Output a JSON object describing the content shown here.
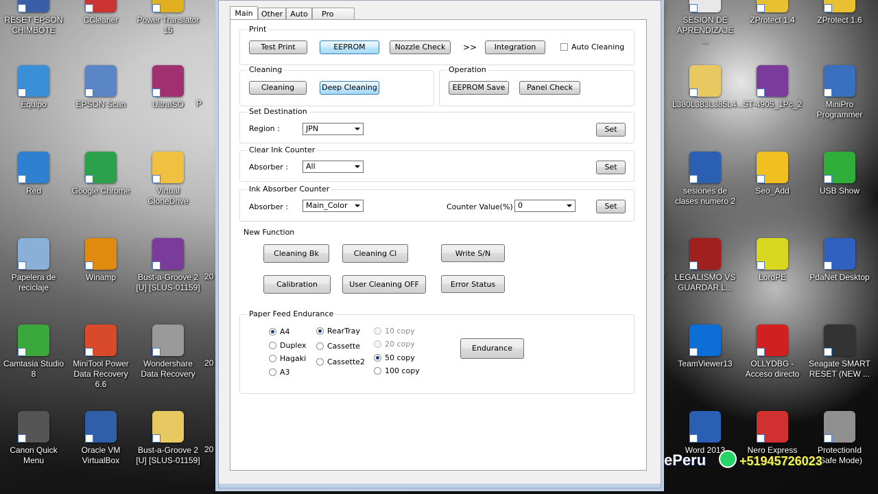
{
  "desktop_left": [
    {
      "label": "RESET EPSON CHIMBOTE",
      "icon": "epson-reset-icon",
      "color": "#3a5fa8"
    },
    {
      "label": "CCleaner",
      "icon": "ccleaner-icon",
      "color": "#cc3333"
    },
    {
      "label": "Power Translator 15",
      "icon": "translator-icon",
      "color": "#e0b020"
    },
    {
      "label": "Equipo",
      "icon": "computer-icon",
      "color": "#3b8fd8"
    },
    {
      "label": "EPSON Scan",
      "icon": "scanner-icon",
      "color": "#5a86c8"
    },
    {
      "label": "UltraISO",
      "icon": "disc-icon",
      "color": "#a03070"
    },
    {
      "label": "Red",
      "icon": "network-icon",
      "color": "#2f80d0"
    },
    {
      "label": "Google Chrome",
      "icon": "chrome-icon",
      "color": "#2aa14a"
    },
    {
      "label": "Virtual CloneDrive",
      "icon": "sheep-icon",
      "color": "#f0c040"
    },
    {
      "label": "Papelera de reciclaje",
      "icon": "recycle-bin-icon",
      "color": "#8ab0d8"
    },
    {
      "label": "Winamp",
      "icon": "winamp-icon",
      "color": "#e08a10"
    },
    {
      "label": "Bust-a-Groove 2 [U] [SLUS-01159]",
      "icon": "archive-icon",
      "color": "#7a3b9a"
    },
    {
      "label": "Camtasia Studio 8",
      "icon": "camtasia-icon",
      "color": "#3aa83a"
    },
    {
      "label": "MiniTool Power Data Recovery 6.6",
      "icon": "recovery-icon",
      "color": "#d84a2a"
    },
    {
      "label": "Wondershare Data Recovery",
      "icon": "hdd-icon",
      "color": "#9a9a9a"
    },
    {
      "label": "Canon Quick Menu",
      "icon": "canon-icon",
      "color": "#555555"
    },
    {
      "label": "Oracle VM VirtualBox",
      "icon": "virtualbox-icon",
      "color": "#2f5fa8"
    },
    {
      "label": "Bust-a-Groove 2 [U] [SLUS-01159]",
      "icon": "folder-icon",
      "color": "#e8c860"
    }
  ],
  "desktop_partial_labels": [
    "P",
    "20",
    "20",
    "20"
  ],
  "desktop_right": [
    {
      "label": "SESION DE APRENDIZAJE ...",
      "icon": "document-icon",
      "color": "#e8e8e8"
    },
    {
      "label": "ZProtect 1.4",
      "icon": "zprotect-icon",
      "color": "#e8c030"
    },
    {
      "label": "ZProtect 1.6",
      "icon": "zprotect-icon",
      "color": "#e8c030"
    },
    {
      "label": "L380L383L385L4...",
      "icon": "folder-icon",
      "color": "#e8c860"
    },
    {
      "label": "ST-4905_1Pc_2",
      "icon": "winrar-icon",
      "color": "#7a3b9a"
    },
    {
      "label": "MiniPro Programmer",
      "icon": "programmer-icon",
      "color": "#3a70c0"
    },
    {
      "label": "sesiones de clases numero 2",
      "icon": "word-doc-icon",
      "color": "#2b5fb4"
    },
    {
      "label": "Seo_Add",
      "icon": "bulb-icon",
      "color": "#f0c020"
    },
    {
      "label": "USB Show",
      "icon": "usb-show-icon",
      "color": "#2fae3a"
    },
    {
      "label": "LEGALISMO VS GUARDAR L...",
      "icon": "video-icon",
      "color": "#a02020"
    },
    {
      "label": "LordPE",
      "icon": "radiation-icon",
      "color": "#d8d820"
    },
    {
      "label": "PdaNet Desktop",
      "icon": "pdanet-icon",
      "color": "#3060c0"
    },
    {
      "label": "TeamViewer13",
      "icon": "teamviewer-icon",
      "color": "#0e6ed8"
    },
    {
      "label": "OLLYDBG - Acceso directo",
      "icon": "bug-icon",
      "color": "#d02020"
    },
    {
      "label": "Seagate SMART RESET (NEW ...",
      "icon": "mkv-icon",
      "color": "#333333"
    },
    {
      "label": "Word 2013",
      "icon": "word-icon",
      "color": "#2b5fb4"
    },
    {
      "label": "Nero Express",
      "icon": "nero-icon",
      "color": "#d03030"
    },
    {
      "label": "ProtectionId (Safe Mode)",
      "icon": "protectionid-icon",
      "color": "#909090"
    }
  ],
  "desktop_partial_right": "T",
  "watermark": {
    "brand": "ePeru",
    "phone": "+51945726023"
  },
  "tabs": [
    "Main",
    "Other",
    "Auto",
    "Pro"
  ],
  "print": {
    "title": "Print",
    "test_print": "Test Print",
    "eeprom": "EEPROM",
    "nozzle_check": "Nozzle Check",
    "arrows": ">>",
    "integration": "Integration",
    "auto_cleaning": "Auto Cleaning"
  },
  "cleaning": {
    "title": "Cleaning",
    "cleaning": "Cleaning",
    "deep_cleaning": "Deep Cleaning"
  },
  "operation": {
    "title": "Operation",
    "eeprom_save": "EEPROM Save",
    "panel_check": "Panel Check"
  },
  "destination": {
    "title": "Set Destination",
    "region_label": "Region :",
    "region_value": "JPN",
    "set": "Set"
  },
  "clear_ink": {
    "title": "Clear Ink Counter",
    "absorber_label": "Absorber :",
    "absorber_value": "All",
    "set": "Set"
  },
  "ink_absorber": {
    "title": "Ink Absorber Counter",
    "absorber_label": "Absorber :",
    "absorber_value": "Main_Color",
    "counter_label": "Counter Value(%) :",
    "counter_value": "0",
    "set": "Set"
  },
  "new_function": {
    "title": "New Function",
    "cleaning_bk": "Cleaning Bk",
    "cleaning_cl": "Cleaning Cl",
    "write_sn": "Write S/N",
    "calibration": "Calibration",
    "user_cleaning_off": "User Cleaning OFF",
    "error_status": "Error Status"
  },
  "paper_feed": {
    "title": "Paper Feed Endurance",
    "sizes": [
      "A4",
      "Duplex",
      "Hagaki",
      "A3"
    ],
    "sources": [
      "RearTray",
      "Cassette",
      "Cassette2"
    ],
    "copies": [
      "10 copy",
      "20 copy",
      "50 copy",
      "100 copy"
    ],
    "endurance": "Endurance"
  }
}
